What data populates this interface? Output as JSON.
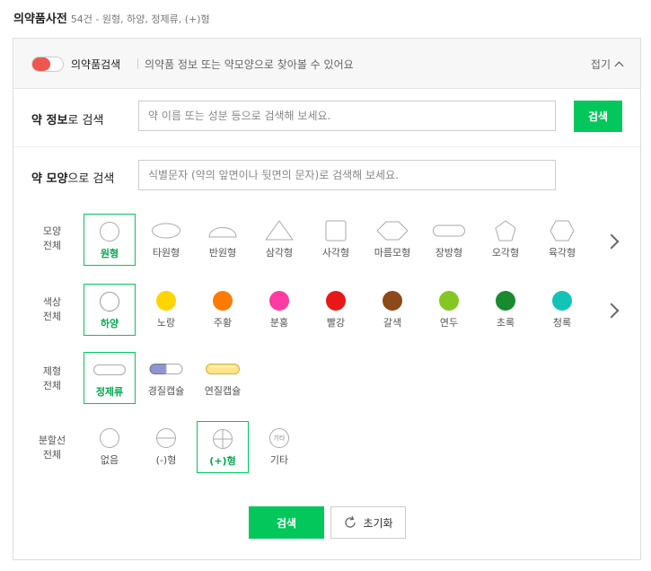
{
  "header": {
    "title": "의약품사전",
    "subtitle": "54건 - 원형, 하양, 정제류, (+)형"
  },
  "mode": {
    "toggle_label": "의약품검색",
    "description": "의약품 정보 또는 약모양으로 찾아볼 수 있어요",
    "collapse_label": "접기"
  },
  "info_search": {
    "label_bold": "약 정보",
    "label_rest": "로 검색",
    "placeholder": "약 이름 또는 성분 등으로 검색해 보세요.",
    "button": "검색"
  },
  "shape_search": {
    "label_bold": "약 모양",
    "label_rest": "으로 검색",
    "placeholder": "식별문자 (약의 앞면이나 뒷면의 문자)로 검색해 보세요."
  },
  "filters": {
    "shape": {
      "title1": "모양",
      "title2": "전체",
      "options": [
        "원형",
        "타원형",
        "반원형",
        "삼각형",
        "사각형",
        "마름모형",
        "장방형",
        "오각형",
        "육각형"
      ],
      "selected": "원형"
    },
    "color": {
      "title1": "색상",
      "title2": "전체",
      "options": [
        "하양",
        "노랑",
        "주황",
        "분홍",
        "빨강",
        "갈색",
        "연두",
        "초록",
        "청록"
      ],
      "colors": [
        "#ffffff",
        "#ffd400",
        "#ff7a00",
        "#ff3aa0",
        "#e81818",
        "#8b4a17",
        "#84c725",
        "#1a8a30",
        "#14c3b8"
      ],
      "selected": "하양"
    },
    "form": {
      "title1": "제형",
      "title2": "전체",
      "options": [
        "정제류",
        "경질캡슐",
        "연질캡슐"
      ],
      "selected": "정제류"
    },
    "split": {
      "title1": "분할선",
      "title2": "전체",
      "options": [
        "없음",
        "(-)형",
        "(+)형",
        "기타"
      ],
      "icon_text": "기타",
      "selected": "(+)형"
    }
  },
  "actions": {
    "search": "검색",
    "reset": "초기화"
  }
}
